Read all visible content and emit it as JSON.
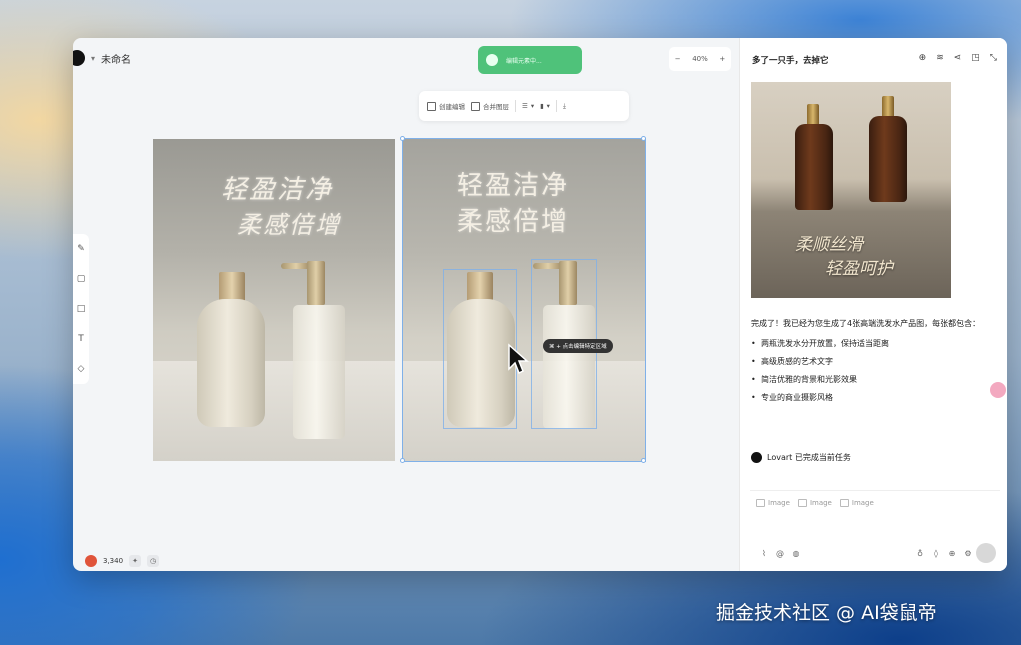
{
  "app": {
    "doc_title": "未命名"
  },
  "toast": {
    "text": "编辑元素中..."
  },
  "zoom": {
    "minus": "−",
    "level": "40%",
    "plus": "+"
  },
  "float_toolbar": {
    "item1": "创建编辑",
    "item2": "合并图层"
  },
  "canvas": {
    "left_image": {
      "line1": "轻盈洁净",
      "line2": "柔感倍增"
    },
    "right_image": {
      "line1": "轻盈洁净",
      "line2": "柔感倍增"
    },
    "cursor_tip": "⌘ + 点击编辑特定区域"
  },
  "status": {
    "credits": "3,340"
  },
  "panel": {
    "title": "多了一只手，去掉它",
    "preview": {
      "line1": "柔顺丝滑",
      "line2": "轻盈呵护"
    },
    "message_intro": "完成了！我已经为您生成了4张高端洗发水产品图，每张都包含：",
    "bullets": [
      "两瓶洗发水分开放置，保持适当距离",
      "高级质感的艺术文字",
      "简洁优雅的背景和光影效果",
      "专业的商业摄影风格"
    ],
    "done_text": "Lovart 已完成当前任务",
    "chips": [
      "Image",
      "Image",
      "Image"
    ]
  },
  "watermark": "掘金技术社区 @ AI袋鼠帝",
  "colors": {
    "accent_green": "#4fc27a",
    "selection_blue": "#7fb0e8",
    "credit_badge": "#e0543a"
  }
}
